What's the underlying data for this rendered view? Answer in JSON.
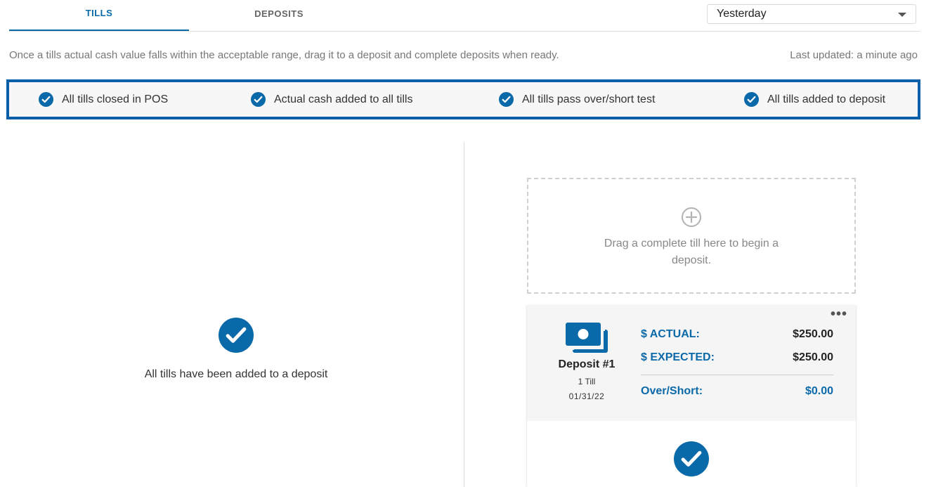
{
  "tabs": [
    {
      "label": "TILLS",
      "active": true
    },
    {
      "label": "DEPOSITS",
      "active": false
    }
  ],
  "date_filter": {
    "selected": "Yesterday",
    "icon": "chevron-down-icon"
  },
  "instruction": "Once a tills actual cash value falls within the acceptable range, drag it to a deposit and complete deposits when ready.",
  "last_updated": "Last updated: a minute ago",
  "checklist": [
    {
      "label": "All tills closed in POS",
      "icon": "check-circle-icon",
      "done": true
    },
    {
      "label": "Actual cash added to all tills",
      "icon": "check-circle-icon",
      "done": true
    },
    {
      "label": "All tills pass over/short test",
      "icon": "check-circle-icon",
      "done": true
    },
    {
      "label": "All tills added to deposit",
      "icon": "check-circle-icon",
      "done": true
    }
  ],
  "tills_panel": {
    "empty_message": "All tills have been added to a deposit",
    "icon": "check-circle-icon"
  },
  "dropzone": {
    "text": "Drag a complete till here to begin a deposit.",
    "icon": "plus-circle-icon"
  },
  "deposit": {
    "name": "Deposit #1",
    "tills": "1 Till",
    "date": "01/31/22",
    "icon": "money-icon",
    "more_label": "•••",
    "actual_label": "$ ACTUAL:",
    "actual_value": "$250.00",
    "expected_label": "$ EXPECTED:",
    "expected_value": "$250.00",
    "over_short_label": "Over/Short:",
    "over_short_value": "$0.00"
  },
  "colors": {
    "accent": "#0a69a8",
    "checklist_border": "#0b5ea8",
    "check_icon": "#0a69a8"
  }
}
